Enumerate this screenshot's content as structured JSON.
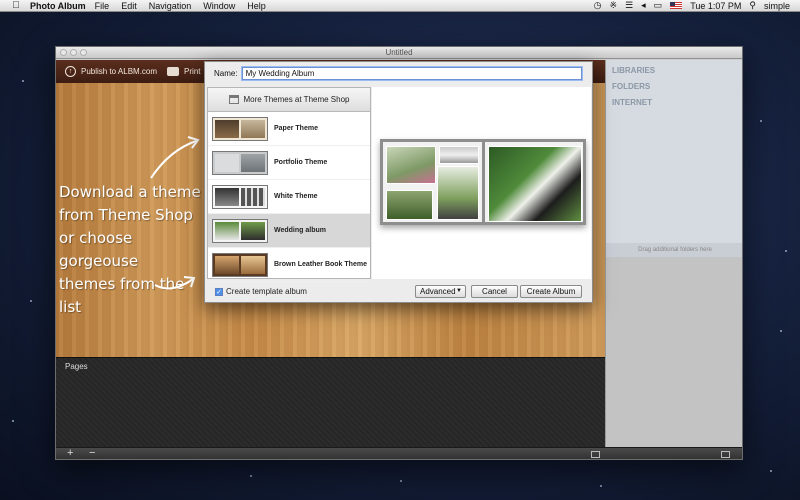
{
  "menubar": {
    "app_name": "Photo Album",
    "menus": [
      "File",
      "Edit",
      "Navigation",
      "Window",
      "Help"
    ],
    "clock": "Tue 1:07 PM",
    "user": "simple",
    "icons": [
      "apple-icon",
      "time-machine-icon",
      "bluetooth-icon",
      "wifi-icon",
      "volume-icon",
      "battery-icon",
      "flag-icon",
      "search-icon"
    ]
  },
  "window": {
    "title": "Untitled"
  },
  "toolbar": {
    "publish_label": "Publish to ALBM.com",
    "print_label": "Print"
  },
  "hint": {
    "lines": [
      "Download a theme",
      "from Theme Shop",
      "or choose gorgeouse",
      "themes from the",
      "list"
    ]
  },
  "dialog": {
    "name_label": "Name:",
    "name_value": "My Wedding Album",
    "more_themes_label": "More Themes at Theme Shop",
    "themes": [
      {
        "name": "Paper Theme",
        "selected": false
      },
      {
        "name": "Portfolio Theme",
        "selected": false
      },
      {
        "name": "White Theme",
        "selected": false
      },
      {
        "name": "Wedding album",
        "selected": true
      },
      {
        "name": "Brown Leather Book Theme",
        "selected": false
      }
    ],
    "create_template_label": "Create template album",
    "create_template_checked": true,
    "advanced_label": "Advanced",
    "cancel_label": "Cancel",
    "create_label": "Create Album"
  },
  "pages": {
    "label": "Pages"
  },
  "sidebar": {
    "sections": [
      "LIBRARIES",
      "FOLDERS",
      "INTERNET"
    ],
    "drag_hint": "Drag additional folders here"
  },
  "bottombar": {
    "add": "+",
    "remove": "−"
  }
}
